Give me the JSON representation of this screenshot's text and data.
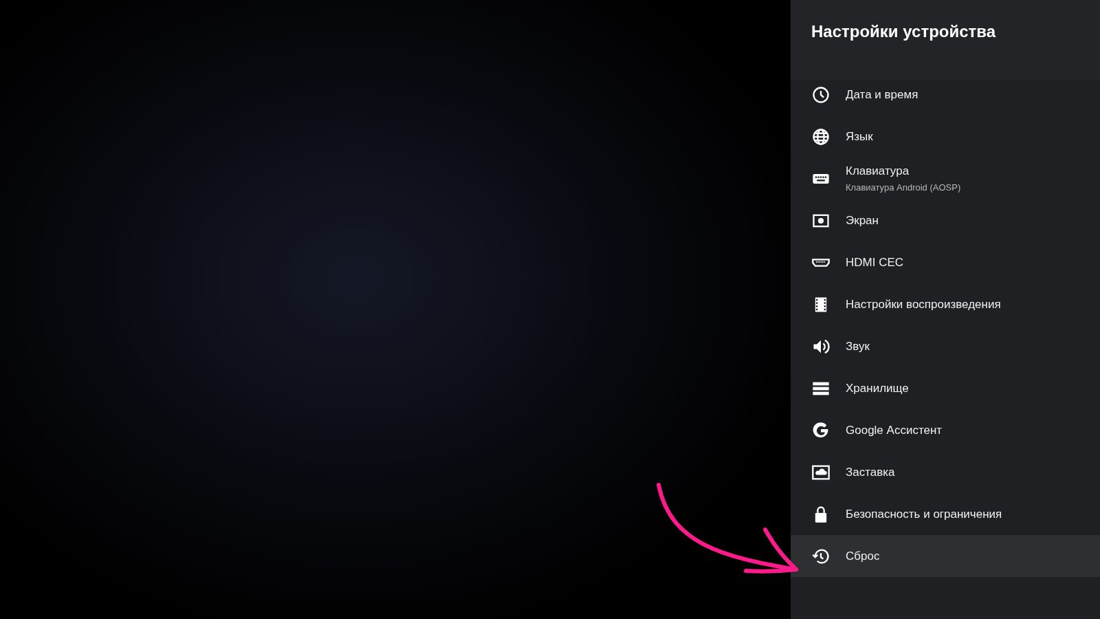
{
  "panel": {
    "title": "Настройки устройства",
    "items": [
      {
        "kind": "clock",
        "label": "Дата и время",
        "selected": false
      },
      {
        "kind": "globe",
        "label": "Язык",
        "selected": false
      },
      {
        "kind": "keyboard",
        "label": "Клавиатура",
        "subtitle": "Клавиатура Android (AOSP)",
        "selected": false
      },
      {
        "kind": "screen",
        "label": "Экран",
        "selected": false
      },
      {
        "kind": "hdmi",
        "label": "HDMI CEC",
        "selected": false
      },
      {
        "kind": "film",
        "label": "Настройки воспроизведения",
        "selected": false
      },
      {
        "kind": "sound",
        "label": "Звук",
        "selected": false
      },
      {
        "kind": "storage",
        "label": "Хранилище",
        "selected": false
      },
      {
        "kind": "google",
        "label": "Google Ассистент",
        "selected": false
      },
      {
        "kind": "screensaver",
        "label": "Заставка",
        "selected": false
      },
      {
        "kind": "lock",
        "label": "Безопасность и ограничения",
        "selected": false
      },
      {
        "kind": "reset",
        "label": "Сброс",
        "selected": true
      }
    ]
  }
}
